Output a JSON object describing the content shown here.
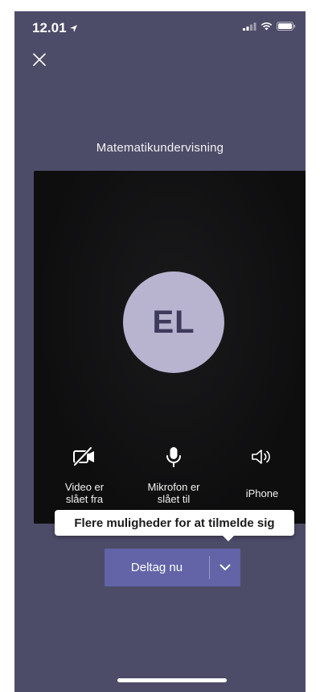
{
  "status_bar": {
    "time": "12.01"
  },
  "meeting": {
    "title": "Matematikundervisning"
  },
  "avatar": {
    "initials": "EL"
  },
  "controls": [
    {
      "label_line1": "Video er",
      "label_line2": "slået fra",
      "icon": "video-off-icon"
    },
    {
      "label_line1": "Mikrofon er",
      "label_line2": "slået til",
      "icon": "microphone-icon"
    },
    {
      "label_line1": "iPhone",
      "label_line2": "",
      "icon": "speaker-icon"
    }
  ],
  "tooltip": {
    "text": "Flere muligheder for at tilmelde sig"
  },
  "join": {
    "label": "Deltag nu"
  },
  "colors": {
    "background": "#4d4c68",
    "preview": "#0e0e0f",
    "avatar": "#b8b4cf",
    "accent": "#6264a7"
  }
}
